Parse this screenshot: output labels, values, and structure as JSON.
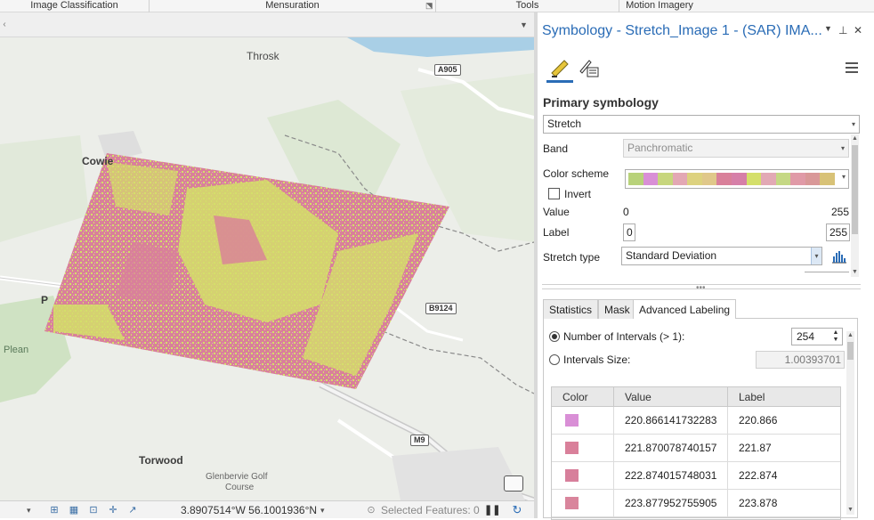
{
  "ribbon": {
    "groups": [
      "Image Classification",
      "Mensuration",
      "Tools",
      "Motion Imagery"
    ]
  },
  "map": {
    "labels": {
      "throsk": "Throsk",
      "cowie": "Cowie",
      "plean": "Plean",
      "torwood": "Torwood",
      "glenbervie": "Glenbervie Golf",
      "course": "Course",
      "p_label": "P"
    },
    "roads": {
      "a905": "A905",
      "b9124": "B9124",
      "m9": "M9"
    },
    "colors": {
      "raster_pink": "#d9809a",
      "raster_yellow": "#d4df6a",
      "water": "#a9cfe6",
      "land": "#eceee9",
      "green": "#cfe2c3"
    }
  },
  "statusbar": {
    "coordinates": "3.8907514°W 56.1001936°N",
    "coord_dropdown": "▾",
    "selected_features": "Selected Features: 0"
  },
  "pane": {
    "title": "Symbology - Stretch_Image 1 - (SAR) IMA...",
    "primary_symbology_heading": "Primary symbology",
    "renderer": "Stretch",
    "band_label": "Band",
    "band_value": "Panchromatic",
    "color_scheme_label": "Color scheme",
    "color_scheme_colors": [
      "#b8d27a",
      "#d98fd6",
      "#c7d67d",
      "#e3a8b4",
      "#ddd27f",
      "#e0c88a",
      "#d9809a",
      "#d67fa8",
      "#d4df6a",
      "#e2a9b5",
      "#c5d884",
      "#e09aa7",
      "#d99898",
      "#d8c277"
    ],
    "invert_label": "Invert",
    "value_label": "Value",
    "value_min": "0",
    "value_max": "255",
    "label_label": "Label",
    "label_min": "0",
    "label_max": "255",
    "stretch_type_label": "Stretch type",
    "stretch_type_value": "Standard Deviation",
    "tabs": [
      "Statistics",
      "Mask",
      "Advanced Labeling"
    ],
    "num_intervals_label": "Number of Intervals (> 1):",
    "num_intervals_value": "254",
    "interval_size_label": "Intervals Size:",
    "interval_size_value": "1.00393701",
    "grid": {
      "headers": [
        "Color",
        "Value",
        "Label"
      ],
      "rows": [
        {
          "color": "#d98fd6",
          "value": "220.866141732283",
          "label": "220.866"
        },
        {
          "color": "#d9809a",
          "value": "221.870078740157",
          "label": "221.87"
        },
        {
          "color": "#d77f9b",
          "value": "222.874015748031",
          "label": "222.874"
        },
        {
          "color": "#d9859c",
          "value": "223.877952755905",
          "label": "223.878"
        }
      ]
    }
  }
}
